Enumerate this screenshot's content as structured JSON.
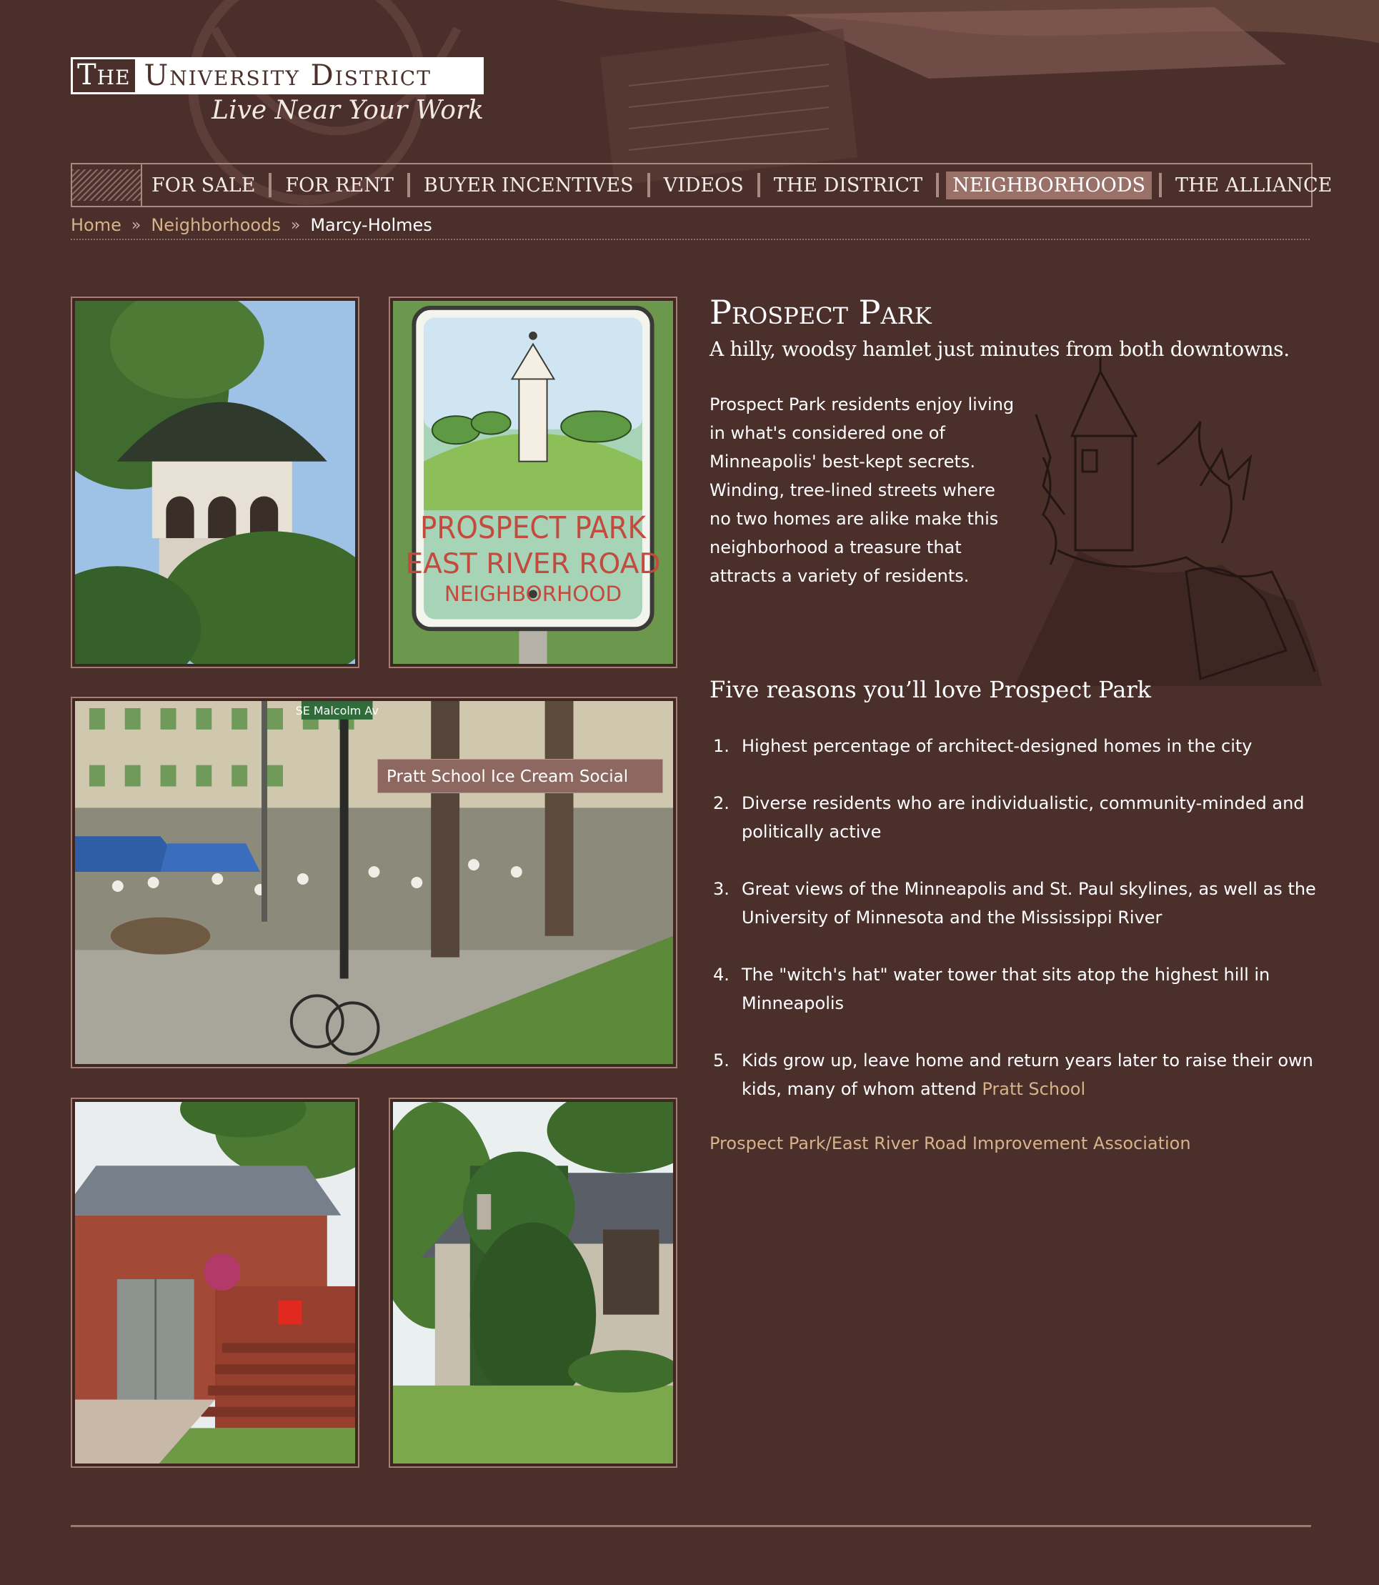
{
  "logo": {
    "the": "The",
    "name": "University District",
    "tagline": "Live Near Your Work"
  },
  "nav": {
    "items": [
      {
        "label": "FOR SALE"
      },
      {
        "label": "FOR RENT"
      },
      {
        "label": "BUYER INCENTIVES"
      },
      {
        "label": "VIDEOS"
      },
      {
        "label": "THE DISTRICT"
      },
      {
        "label": "NEIGHBORHOODS",
        "active": true
      },
      {
        "label": "THE ALLIANCE"
      }
    ]
  },
  "breadcrumb": {
    "items": [
      "Home",
      "Neighborhoods",
      "Marcy-Holmes"
    ],
    "separator": "»"
  },
  "photos": {
    "caption": "Pratt School Ice Cream Social",
    "sign_line1": "PROSPECT PARK",
    "sign_line2": "EAST RIVER ROAD",
    "sign_line3": "NEIGHBORHOOD",
    "street_sign": "SE Malcolm Av"
  },
  "content": {
    "title": "Prospect Park",
    "subtitle": "A hilly, woodsy hamlet just minutes from both downtowns.",
    "intro": "Prospect Park residents enjoy living in what's considered one of Minneapolis' best-kept secrets. Winding, tree-lined streets where no two homes are alike make this neighborhood a treasure that attracts a variety of residents.",
    "reasons_heading": "Five reasons you’ll love Prospect Park",
    "reasons": [
      {
        "num": "1.",
        "text": "Highest percentage of architect-designed homes in the city"
      },
      {
        "num": "2.",
        "text": "Diverse residents who are individualistic, community-minded and politically active"
      },
      {
        "num": "3.",
        "text": "Great views of the Minneapolis and St. Paul skylines, as well as the University of Minnesota and the Mississippi River"
      },
      {
        "num": "4.",
        "text": "The \"witch's hat\" water tower that sits atop the highest hill in Minneapolis"
      },
      {
        "num": "5.",
        "text": "Kids grow up, leave home and return years later to raise their own kids, many of whom attend ",
        "link": "Pratt School"
      }
    ],
    "association_link": "Prospect Park/East River Road Improvement Association"
  },
  "colors": {
    "background": "#4a2f2b",
    "link": "#d6b38a",
    "nav_active": "#9a7169",
    "border": "#a57d73"
  }
}
